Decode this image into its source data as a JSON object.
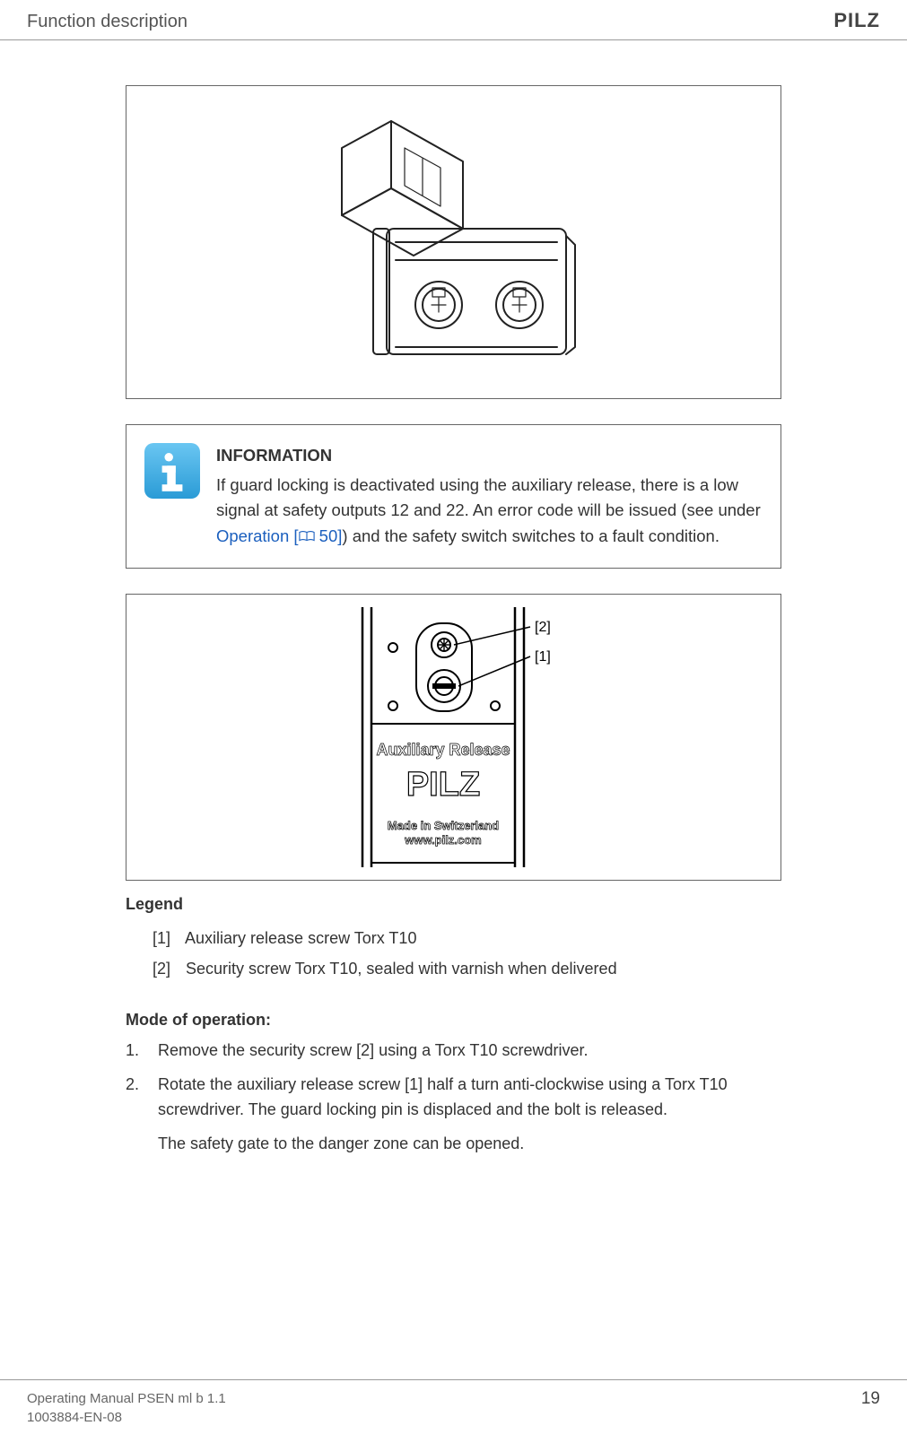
{
  "header": {
    "section_title": "Function description",
    "brand": "PILZ"
  },
  "info": {
    "heading": "INFORMATION",
    "body_part1": "If guard locking is deactivated using the auxiliary release, there is a low signal at safety outputs 12 and 22. An error code will be issued (see under ",
    "link_text": "Operation [",
    "link_page": " 50]",
    "body_part2": ") and the safety switch switches to a fault condition."
  },
  "fig2": {
    "callout_1": "[1]",
    "callout_2": "[2]",
    "label_aux": "Auxiliary Release",
    "label_pilz": "PILZ",
    "label_made": "Made in Switzerland",
    "label_www": "www.pilz.com"
  },
  "legend": {
    "title": "Legend",
    "items": [
      {
        "key": "[1]",
        "text": "Auxiliary release screw Torx T10"
      },
      {
        "key": "[2]",
        "text": "Security screw Torx T10, sealed with varnish when delivered"
      }
    ]
  },
  "mode": {
    "title": "Mode of operation:",
    "steps": [
      {
        "num": "1.",
        "text": "Remove the security screw [2] using a Torx T10 screwdriver."
      },
      {
        "num": "2.",
        "text": "Rotate the auxiliary release screw [1] half a turn anti-clockwise using a Torx T10 screwdriver. The guard locking pin is displaced and the bolt is released."
      }
    ],
    "extra": "The safety gate to the danger zone can be opened."
  },
  "footer": {
    "line1": "Operating Manual PSEN ml b 1.1",
    "line2": "1003884-EN-08",
    "page": "19"
  }
}
